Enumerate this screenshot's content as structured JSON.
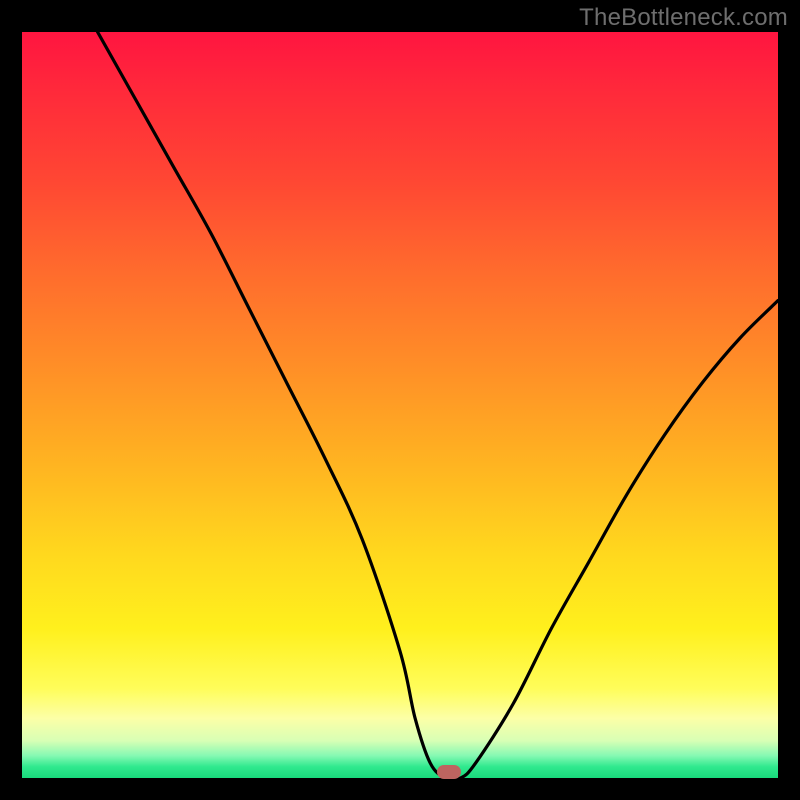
{
  "watermark": "TheBottleneck.com",
  "chart_data": {
    "type": "line",
    "title": "",
    "xlabel": "",
    "ylabel": "",
    "xlim": [
      0,
      100
    ],
    "ylim": [
      0,
      100
    ],
    "grid": false,
    "legend": false,
    "series": [
      {
        "name": "bottleneck-curve",
        "x": [
          10,
          15,
          20,
          25,
          30,
          35,
          40,
          45,
          50,
          52,
          54,
          56,
          58,
          60,
          65,
          70,
          75,
          80,
          85,
          90,
          95,
          100
        ],
        "y": [
          100,
          91,
          82,
          73,
          63,
          53,
          43,
          32,
          17,
          8,
          2,
          0,
          0,
          2,
          10,
          20,
          29,
          38,
          46,
          53,
          59,
          64
        ]
      }
    ],
    "marker": {
      "x": 56.5,
      "y": 0.8,
      "color": "#be6460"
    },
    "background_gradient": {
      "stops": [
        {
          "pos": 0,
          "color": "#ff1540"
        },
        {
          "pos": 0.45,
          "color": "#ff8f27"
        },
        {
          "pos": 0.8,
          "color": "#fff01d"
        },
        {
          "pos": 0.97,
          "color": "#86f9b3"
        },
        {
          "pos": 1.0,
          "color": "#19da7c"
        }
      ]
    }
  }
}
